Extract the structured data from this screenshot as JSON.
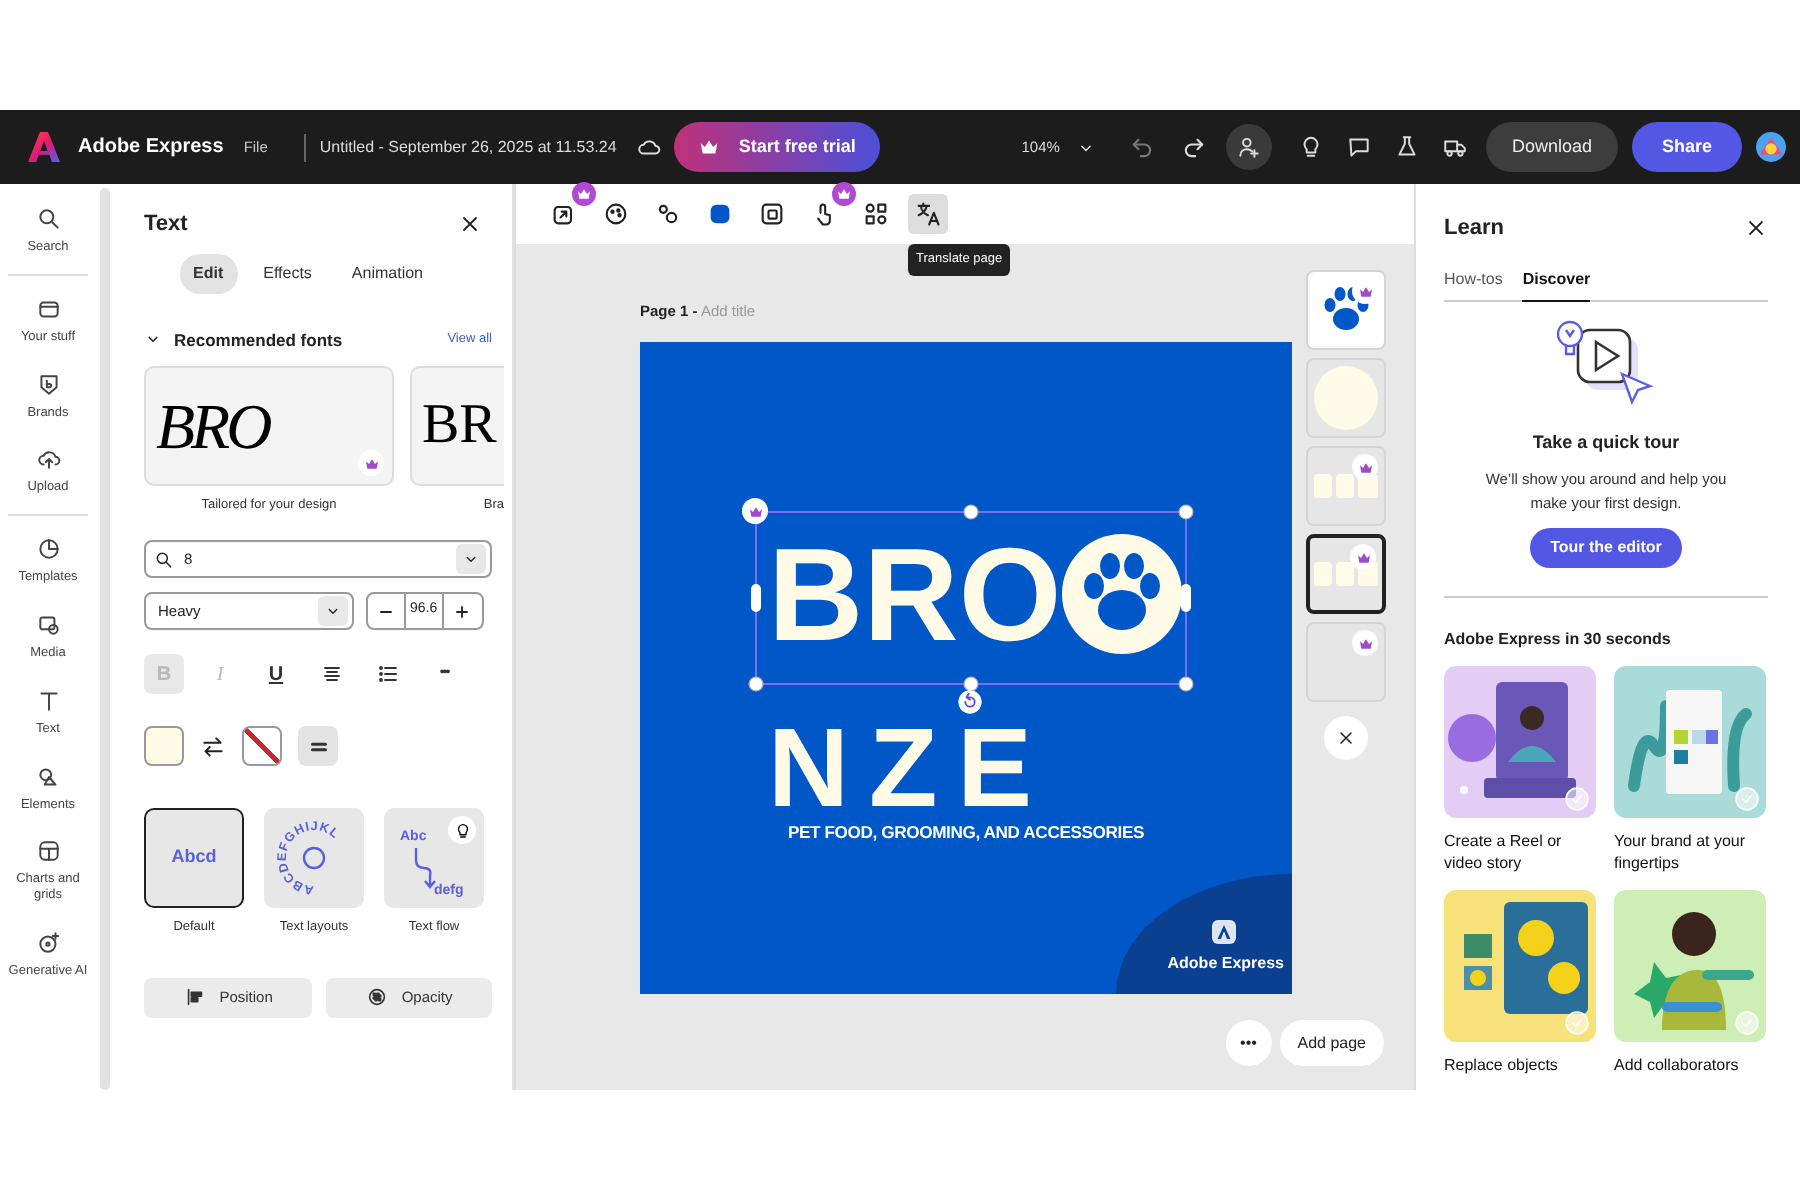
{
  "topbar": {
    "app_name": "Adobe Express",
    "menu": "File",
    "doc_title": "Untitled - September 26, 2025 at 11.53.24",
    "trial_button": "Start free trial",
    "zoom": "104%",
    "download_button": "Download",
    "share_button": "Share"
  },
  "rail": [
    {
      "label": "Search",
      "kind": "search",
      "divider_after": true
    },
    {
      "label": "Your stuff",
      "kind": "folder",
      "divider_after": false
    },
    {
      "label": "Brands",
      "kind": "brand",
      "divider_after": false
    },
    {
      "label": "Upload",
      "kind": "upload",
      "divider_after": true
    },
    {
      "label": "Templates",
      "kind": "templates",
      "divider_after": false
    },
    {
      "label": "Media",
      "kind": "media",
      "divider_after": false
    },
    {
      "label": "Text",
      "kind": "text",
      "divider_after": false
    },
    {
      "label": "Elements",
      "kind": "elements",
      "divider_after": false
    },
    {
      "label": "Charts and grids",
      "kind": "charts",
      "divider_after": false
    },
    {
      "label": "Generative AI",
      "kind": "genai",
      "divider_after": false
    }
  ],
  "text_panel": {
    "title": "Text",
    "tabs": [
      {
        "label": "Edit",
        "selected": true
      },
      {
        "label": "Effects",
        "selected": false
      },
      {
        "label": "Animation",
        "selected": false
      }
    ],
    "fonts_heading": "Recommended fonts",
    "expanded": true,
    "view_all": "View all",
    "font_cards": [
      {
        "sample": "BRO",
        "caption": "Tailored for your design",
        "kind": "script",
        "premium": true
      },
      {
        "sample": "BR",
        "caption": "Bra",
        "kind": "serif",
        "premium": false
      }
    ],
    "font_search": "8",
    "weight": "Heavy",
    "size": "96.6",
    "format": [
      {
        "kind": "bold",
        "glyph": "B",
        "disabled": true
      },
      {
        "kind": "italic",
        "glyph": "I",
        "disabled": true
      },
      {
        "kind": "underline",
        "glyph": "U",
        "disabled": false
      },
      {
        "kind": "align",
        "disabled": false
      },
      {
        "kind": "list",
        "disabled": false
      },
      {
        "kind": "more",
        "glyph": "•••",
        "disabled": false
      }
    ],
    "styles": [
      {
        "kind": "default",
        "label": "Default",
        "sample": "Abcd",
        "selected": true
      },
      {
        "kind": "circle",
        "label": "Text layouts",
        "sample": "ABCDEFGHIJKL",
        "selected": false
      },
      {
        "kind": "flow",
        "label": "Text flow",
        "sample": "Abc",
        "sample_2": "defg",
        "selected": false
      }
    ],
    "actions": [
      {
        "kind": "position",
        "label": "Position"
      },
      {
        "kind": "opacity",
        "label": "Opacity"
      }
    ]
  },
  "canvas": {
    "tools": [
      {
        "kind": "resize",
        "premium": true,
        "selected": false
      },
      {
        "kind": "palette",
        "premium": false,
        "selected": false
      },
      {
        "kind": "link",
        "premium": false,
        "selected": false
      },
      {
        "kind": "color",
        "premium": false,
        "selected": false
      },
      {
        "kind": "frame",
        "premium": false,
        "selected": false
      },
      {
        "kind": "hand",
        "premium": true,
        "selected": false
      },
      {
        "kind": "shapes",
        "premium": false,
        "selected": false
      },
      {
        "kind": "translate",
        "premium": false,
        "selected": true
      }
    ],
    "tooltip": "Translate page",
    "page_label": "Page 1 -",
    "title_placeholder": "Add title",
    "design": {
      "line_1": "BRO",
      "line_2": "NZE",
      "tagline": "PET FOOD, GROOMING, AND ACCESSORIES",
      "badge": "Adobe Express",
      "premium": true
    },
    "thumbnails": [
      {
        "kind": "paw",
        "premium": true,
        "selected": false
      },
      {
        "kind": "circle",
        "premium": false,
        "selected": false
      },
      {
        "kind": "text",
        "premium": true,
        "selected": false
      },
      {
        "kind": "text",
        "premium": true,
        "selected": true
      },
      {
        "kind": "blank",
        "premium": true,
        "selected": false
      }
    ],
    "more_button": "•••",
    "add_page": "Add page"
  },
  "learn": {
    "title": "Learn",
    "tabs": [
      {
        "label": "How-tos",
        "selected": false
      },
      {
        "label": "Discover",
        "selected": true
      }
    ],
    "tour_heading": "Take a quick tour",
    "tour_text": "We’ll show you around and help you make your first design.",
    "tour_button": "Tour the editor",
    "videos_heading": "Adobe Express in 30 seconds",
    "videos": [
      {
        "caption": "Create a Reel or video story",
        "kind": "reel"
      },
      {
        "caption": "Your brand at your fingertips",
        "kind": "brand"
      },
      {
        "caption": "Replace objects",
        "kind": "flowers"
      },
      {
        "caption": "Add collaborators",
        "kind": "person"
      }
    ]
  }
}
